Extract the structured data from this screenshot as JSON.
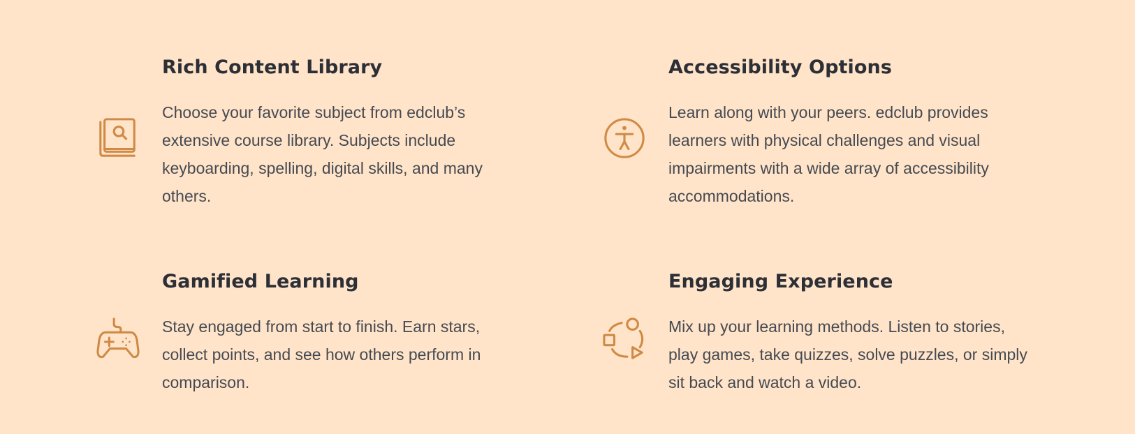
{
  "features": [
    {
      "title": "Rich Content Library",
      "description": "Choose your favorite subject from edclub’s extensive course library. Subjects include keyboarding, spelling, digital skills, and many others.",
      "icon": "book-search-icon"
    },
    {
      "title": "Accessibility Options",
      "description": "Learn along with your peers. edclub provides learners with physical challenges and visual impairments with a wide array of accessibility accommodations.",
      "icon": "accessibility-icon"
    },
    {
      "title": "Gamified Learning",
      "description": "Stay engaged from start to finish. Earn stars, collect points, and see how others perform in comparison.",
      "icon": "gamepad-icon"
    },
    {
      "title": "Engaging Experience",
      "description": "Mix up your learning methods. Listen to stories, play games, take quizzes, solve puzzles, or simply sit back and watch a video.",
      "icon": "shapes-cycle-icon"
    }
  ],
  "colors": {
    "background": "#ffe4c9",
    "icon": "#d08a45",
    "heading": "#2c2f36",
    "body": "#454a52"
  }
}
